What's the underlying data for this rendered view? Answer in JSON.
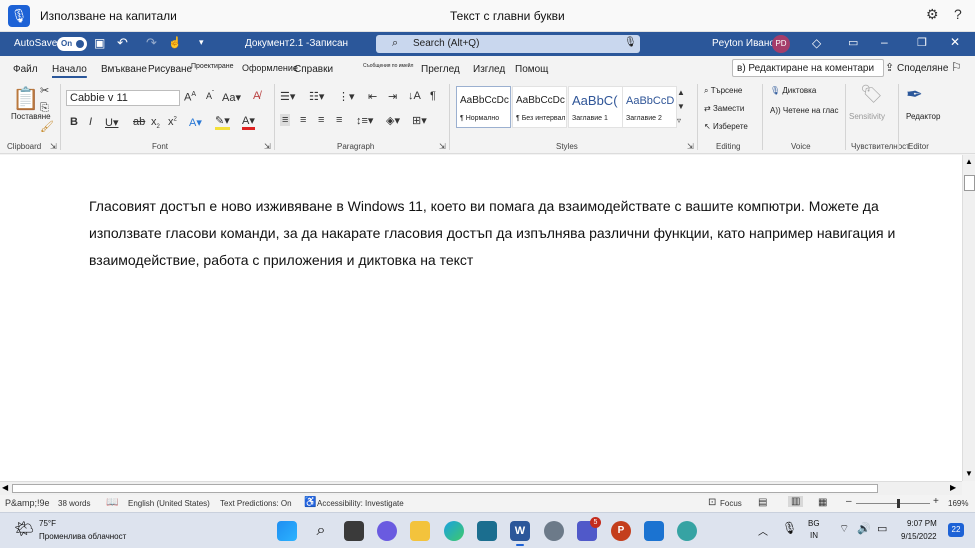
{
  "voice_access": {
    "status": "Използване на капитали",
    "command": "Текст с главни букви"
  },
  "titlebar": {
    "autosave_label": "AutoSave",
    "autosave_state": "On",
    "doc_title": "Документ2.1 -Записан",
    "search_placeholder": "Search (Alt+Q)",
    "user_name": "Peyton Иванова",
    "user_initials": "PD"
  },
  "tabs": [
    {
      "label": "Файл"
    },
    {
      "label": "Начало"
    },
    {
      "label": "Вмъкване"
    },
    {
      "label": "Рисуване"
    },
    {
      "label": "Проектиране"
    },
    {
      "label": "Оформление"
    },
    {
      "label": "Справки"
    },
    {
      "label": "Съобщения по имейл"
    },
    {
      "label": "Преглед"
    },
    {
      "label": "Изглед"
    },
    {
      "label": "Помощ"
    }
  ],
  "tab_actions": {
    "comments": "в) Редактиране на коментари",
    "share": "Споделяне"
  },
  "ribbon": {
    "clipboard": {
      "label": "Clipboard",
      "paste": "Поставяне"
    },
    "font": {
      "label": "Font",
      "font_name": "Cabbie v 11"
    },
    "paragraph": {
      "label": "Paragraph"
    },
    "styles": {
      "label": "Styles",
      "items": [
        {
          "preview": "AaBbCcDc",
          "name": "¶ Нормално"
        },
        {
          "preview": "AaBbCcDc",
          "name": "¶ Без интервал"
        },
        {
          "preview": "AaBbC(",
          "name": "Заглавие 1"
        },
        {
          "preview": "AaBbCcD",
          "name": "Заглавие 2"
        }
      ]
    },
    "editing": {
      "label": "Editing",
      "find": "Търсене",
      "replace": "Замести",
      "select": "Изберете"
    },
    "voice": {
      "label": "Voice",
      "dictate": "Диктовка",
      "read_aloud": "Четене на глас"
    },
    "sensitivity": {
      "label": "Чувствителност",
      "button": "Sensitivity"
    },
    "editor": {
      "label": "Editor",
      "button": "Редактор"
    }
  },
  "document": {
    "text": "Гласовият достъп е ново изживяване в Windows 11, което ви помага да взаимодействате с вашите компютри. Можете да използвате гласови команди, за да накарате гласовия достъп да изпълнява различни функции, като например навигация и взаимодействие, работа с приложения и диктовка на текст"
  },
  "statusbar": {
    "page": "P&amp;!9e",
    "words": "38 words",
    "language": "English (United States)",
    "predictions": "Text Predictions: On",
    "accessibility": "Accessibility: Investigate",
    "focus": "Focus",
    "zoom": "169%"
  },
  "taskbar": {
    "temperature": "75°F",
    "weather": "Променлива облачност",
    "lang_top": "BG",
    "lang_bottom": "IN",
    "time": "9:07 PM",
    "date": "9/15/2022",
    "notifications": "22",
    "teams_badge": "5"
  }
}
